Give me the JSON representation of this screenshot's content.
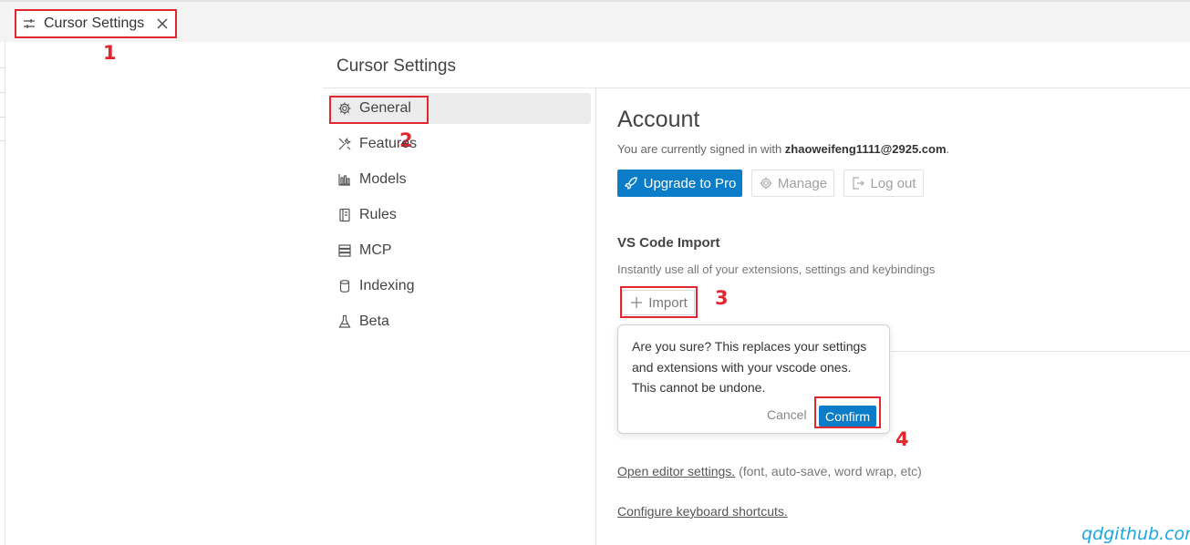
{
  "tab": {
    "title": "Cursor Settings",
    "close_icon": "close-icon",
    "settings_icon": "sliders-icon"
  },
  "annotations": [
    "1",
    "2",
    "3",
    "4"
  ],
  "page_title": "Cursor Settings",
  "sidebar": {
    "items": [
      {
        "label": "General",
        "icon": "gear-icon",
        "active": true
      },
      {
        "label": "Features",
        "icon": "tools-icon",
        "active": false
      },
      {
        "label": "Models",
        "icon": "chart-icon",
        "active": false
      },
      {
        "label": "Rules",
        "icon": "rules-icon",
        "active": false
      },
      {
        "label": "MCP",
        "icon": "server-icon",
        "active": false
      },
      {
        "label": "Indexing",
        "icon": "database-icon",
        "active": false
      },
      {
        "label": "Beta",
        "icon": "flask-icon",
        "active": false
      }
    ]
  },
  "account": {
    "heading": "Account",
    "signed_in_prefix": "You are currently signed in with ",
    "email": "zhaoweifeng1111@2925.com",
    "signed_in_suffix": ".",
    "upgrade_label": "Upgrade to Pro",
    "manage_label": "Manage",
    "logout_label": "Log out"
  },
  "vscode_import": {
    "heading": "VS Code Import",
    "description": "Instantly use all of your extensions, settings and keybindings",
    "import_label": "Import"
  },
  "confirm_popup": {
    "message": "Are you sure? This replaces your settings and extensions with your vscode ones. This cannot be undone.",
    "cancel_label": "Cancel",
    "confirm_label": "Confirm"
  },
  "links": {
    "editor_settings_link": "Open editor settings.",
    "editor_settings_note": " (font, auto-save, word wrap, etc)",
    "keyboard_shortcuts_link": "Configure keyboard shortcuts."
  },
  "watermark": "qdgithub.com",
  "colors": {
    "accent": "#0a7cc8",
    "annotation_red": "#e3262f"
  }
}
